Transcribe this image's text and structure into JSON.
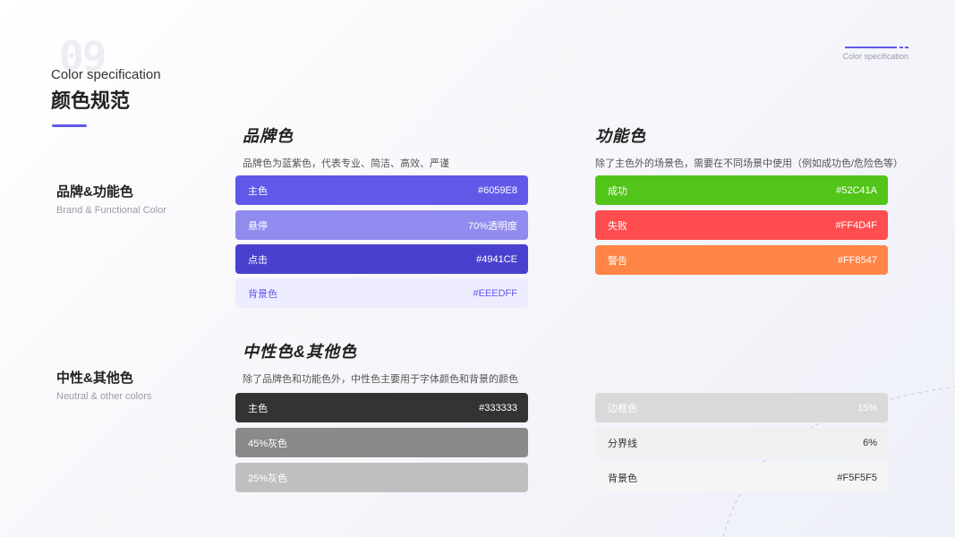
{
  "header": {
    "number": "09",
    "subtitle_en": "Color specification",
    "title_zh": "颜色规范",
    "corner_label": "Color specification"
  },
  "sections": [
    {
      "zh": "品牌&功能色",
      "en": "Brand & Functional Color"
    },
    {
      "zh": "中性&其他色",
      "en": "Neutral & other colors"
    }
  ],
  "brand": {
    "title": "品牌色",
    "desc": "品牌色为蓝紫色，代表专业、简洁、高效、严谨",
    "swatches": [
      {
        "name": "主色",
        "value": "#6059E8",
        "bg": "#6059E8",
        "fg": "#ffffff"
      },
      {
        "name": "悬停",
        "value": "70%透明度",
        "bg": "#918BEF",
        "fg": "#ffffff"
      },
      {
        "name": "点击",
        "value": "#4941CE",
        "bg": "#4941CE",
        "fg": "#ffffff"
      },
      {
        "name": "背景色",
        "value": "#EEEDFF",
        "bg": "#EEEDFF",
        "fg": "#6059E8"
      }
    ]
  },
  "functional": {
    "title": "功能色",
    "desc": "除了主色外的场景色，需要在不同场景中使用（例如成功色/危险色等）",
    "swatches": [
      {
        "name": "成功",
        "value": "#52C41A",
        "bg": "#52C41A",
        "fg": "#ffffff"
      },
      {
        "name": "失败",
        "value": "#FF4D4F",
        "bg": "#FF4D4F",
        "fg": "#ffffff"
      },
      {
        "name": "警告",
        "value": "#FF8547",
        "bg": "#FF8547",
        "fg": "#ffffff"
      }
    ]
  },
  "neutral": {
    "title": "中性色&其他色",
    "desc": "除了品牌色和功能色外，中性色主要用于字体颜色和背景的颜色",
    "swatches": [
      {
        "name": "主色",
        "value": "#333333",
        "bg": "#333333",
        "fg": "#ffffff"
      },
      {
        "name": "45%灰色",
        "value": "",
        "bg": "#8A8A8A",
        "fg": "#ffffff"
      },
      {
        "name": "25%灰色",
        "value": "",
        "bg": "#BFBFBF",
        "fg": "#ffffff"
      }
    ]
  },
  "other": {
    "swatches": [
      {
        "name": "边框色",
        "value": "15%",
        "bg": "#D9D9D9",
        "fg": "#ffffff"
      },
      {
        "name": "分界线",
        "value": "6%",
        "bg": "#F0F0F0",
        "fg": "#333333"
      },
      {
        "name": "背景色",
        "value": "#F5F5F5",
        "bg": "#F5F5F5",
        "fg": "#333333"
      }
    ]
  }
}
